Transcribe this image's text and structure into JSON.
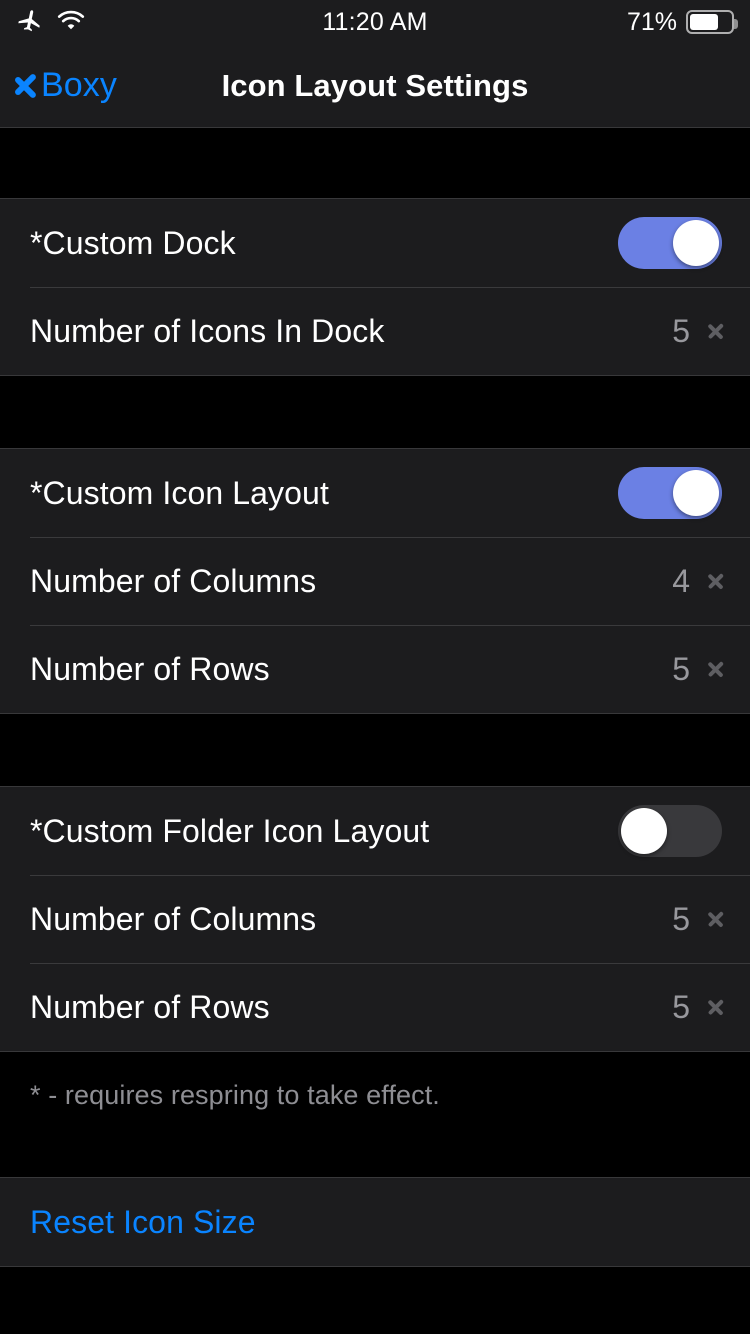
{
  "status_bar": {
    "airplane_icon": "airplane-icon",
    "wifi_icon": "wifi-icon",
    "time": "11:20 AM",
    "battery_percent": "71%",
    "battery_level": 71
  },
  "nav_bar": {
    "back_label": "Boxy",
    "back_icon": "chevron-left-icon",
    "title": "Icon Layout Settings"
  },
  "colors": {
    "accent_blue": "#0a84ff",
    "toggle_on": "#6b80e4",
    "toggle_off": "#39393c",
    "cell_background": "#1c1c1e",
    "page_background": "#000000",
    "separator": "#3a3a3c",
    "value_gray": "#98989d",
    "footer_gray": "#8e8e93"
  },
  "sections": [
    {
      "name": "dock",
      "rows": [
        {
          "label": "*Custom Dock",
          "type": "toggle",
          "value": "on"
        },
        {
          "label": "Number of Icons In Dock",
          "type": "disclosure",
          "value": "5"
        }
      ]
    },
    {
      "name": "icon-layout",
      "rows": [
        {
          "label": "*Custom Icon Layout",
          "type": "toggle",
          "value": "on"
        },
        {
          "label": "Number of Columns",
          "type": "disclosure",
          "value": "4"
        },
        {
          "label": "Number of Rows",
          "type": "disclosure",
          "value": "5"
        }
      ]
    },
    {
      "name": "folder-icon-layout",
      "rows": [
        {
          "label": "*Custom Folder Icon Layout",
          "type": "toggle",
          "value": "off"
        },
        {
          "label": "Number of Columns",
          "type": "disclosure",
          "value": "5"
        },
        {
          "label": "Number of Rows",
          "type": "disclosure",
          "value": "5"
        }
      ]
    }
  ],
  "footer": {
    "note": "* - requires respring to take effect."
  },
  "actions": {
    "reset_label": "Reset Icon Size"
  }
}
